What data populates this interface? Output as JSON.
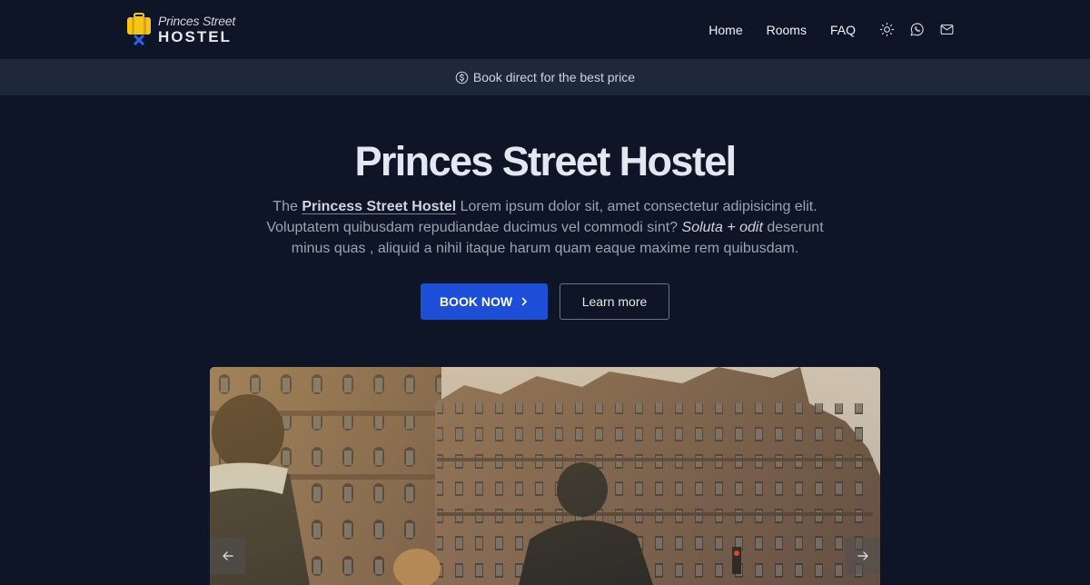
{
  "brand": {
    "line1": "Princes Street",
    "line2": "HOSTEL"
  },
  "nav": {
    "links": [
      "Home",
      "Rooms",
      "FAQ"
    ],
    "icons": [
      "sun-icon",
      "whatsapp-icon",
      "mail-icon"
    ]
  },
  "promo": {
    "icon": "dollar-circle-icon",
    "text": "Book direct for the best price"
  },
  "hero": {
    "title": "Princes Street Hostel",
    "desc_prefix": "The ",
    "desc_highlight": "Princess Street Hostel",
    "desc_mid": " Lorem ipsum dolor sit, amet consectetur adipisicing elit. Voluptatem quibusdam repudiandae ducimus vel commodi sint? ",
    "desc_italic": "Soluta + odit",
    "desc_suffix": " deserunt minus quas , aliquid a nihil itaque harum quam eaque maxime rem quibusdam.",
    "primary_button": "BOOK NOW",
    "secondary_button": "Learn more"
  },
  "carousel": {
    "prev_icon": "arrow-left-icon",
    "next_icon": "arrow-right-icon"
  },
  "colors": {
    "background": "#0e1527",
    "promo_bar": "#1e2838",
    "primary": "#1d4ed8",
    "highlight_underline": "#ec4899",
    "logo": "#f5c518"
  }
}
